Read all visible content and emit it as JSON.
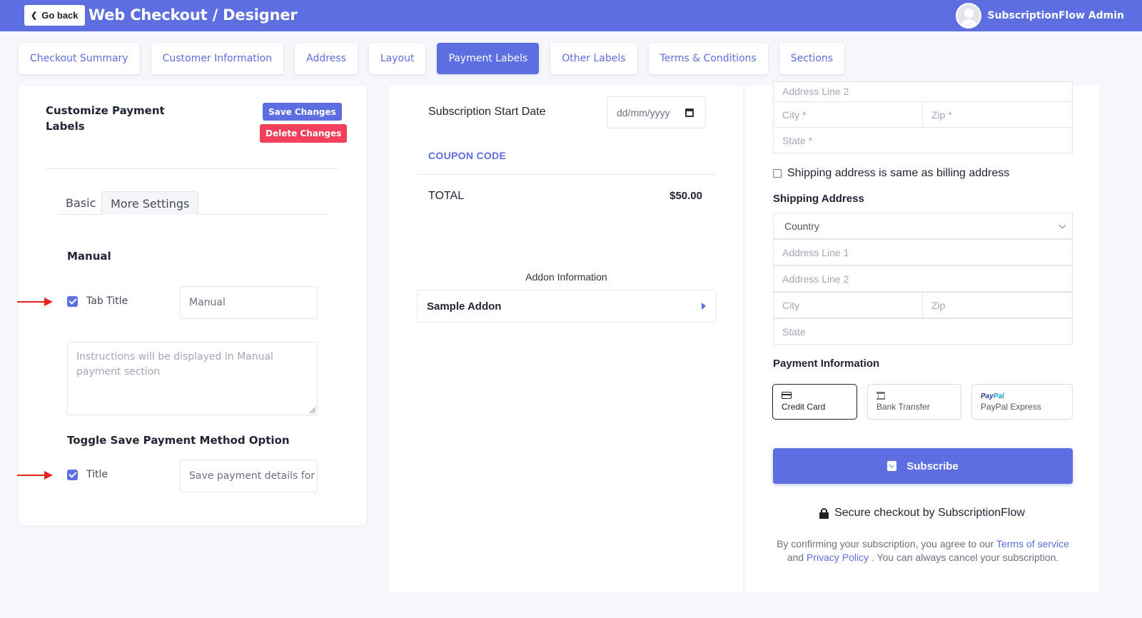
{
  "header": {
    "go_back": "Go back",
    "title": "Web Checkout / Designer",
    "user_name": "SubscriptionFlow Admin"
  },
  "tabs": [
    {
      "label": "Checkout Summary"
    },
    {
      "label": "Customer Information"
    },
    {
      "label": "Address"
    },
    {
      "label": "Layout"
    },
    {
      "label": "Payment Labels",
      "active": true
    },
    {
      "label": "Other Labels"
    },
    {
      "label": "Terms & Conditions"
    },
    {
      "label": "Sections"
    }
  ],
  "left": {
    "title": "Customize Payment Labels",
    "save_label": "Save Changes",
    "delete_label": "Delete Changes",
    "subtab_basic": "Basic",
    "subtab_more": "More Settings",
    "manual_heading": "Manual",
    "tab_title_label": "Tab Title",
    "tab_title_value": "Manual",
    "instructions_placeholder": "Instructions will be displayed in Manual payment section",
    "toggle_heading": "Toggle Save Payment Method Option",
    "title_label": "Title",
    "title_value": "Save payment details for f"
  },
  "middle": {
    "start_date_label": "Subscription Start Date",
    "date_placeholder": "dd/mm/yyyy",
    "coupon": "COUPON CODE",
    "total_label": "TOTAL",
    "total_value": "$50.00",
    "addon_heading": "Addon Information",
    "addon_item": "Sample Addon"
  },
  "right": {
    "billing_line2": "Address Line 2",
    "billing_city": "City *",
    "billing_zip": "Zip *",
    "billing_state": "State *",
    "same_address": "Shipping address is same as billing address",
    "shipping_heading": "Shipping Address",
    "country": "Country",
    "ship_line1": "Address Line 1",
    "ship_line2": "Address Line 2",
    "ship_city": "City",
    "ship_zip": "Zip",
    "ship_state": "State",
    "payment_heading": "Payment Information",
    "pay_credit": "Credit Card",
    "pay_bank": "Bank Transfer",
    "pay_paypal": "PayPal Express",
    "paypal_logo_a": "Pay",
    "paypal_logo_b": "Pal",
    "subscribe": "Subscribe",
    "secure": "Secure checkout by SubscriptionFlow",
    "legal_1": "By confirming your subscription, you agree to our",
    "legal_terms": "Terms of service",
    "legal_2": "and",
    "legal_privacy": "Privacy Policy",
    "legal_3": ". You can always cancel your subscription."
  },
  "colors": {
    "primary": "#5c6ee0",
    "danger": "#f2405b",
    "arrow": "#e8231a"
  }
}
